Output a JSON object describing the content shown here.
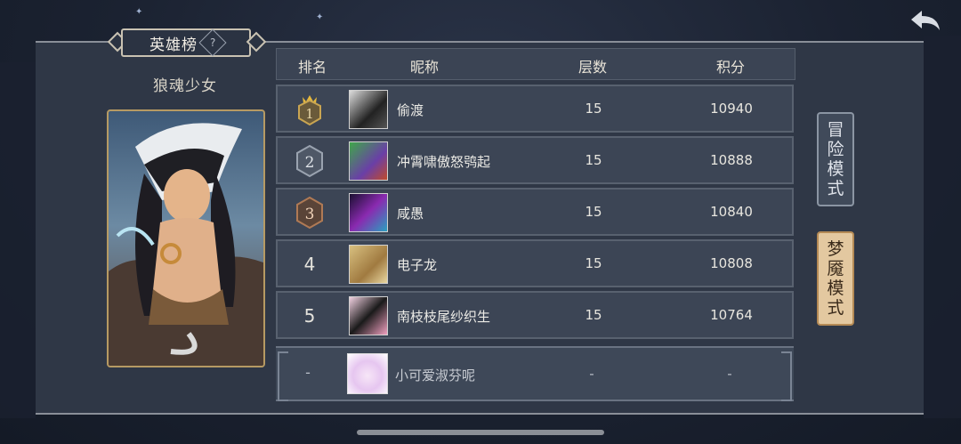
{
  "header": {
    "title": "英雄榜",
    "help_icon_text": "?"
  },
  "hero": {
    "name": "狼魂少女"
  },
  "table": {
    "columns": [
      "排名",
      "昵称",
      "层数",
      "积分"
    ],
    "rows": [
      {
        "rank": "1",
        "name": "偷渡",
        "floor": "15",
        "score": "10940"
      },
      {
        "rank": "2",
        "name": "冲霄啸傲怒鸮起",
        "floor": "15",
        "score": "10888"
      },
      {
        "rank": "3",
        "name": "咸愚",
        "floor": "15",
        "score": "10840"
      },
      {
        "rank": "4",
        "name": "电子龙",
        "floor": "15",
        "score": "10808"
      },
      {
        "rank": "5",
        "name": "南枝枝尾纱织生",
        "floor": "15",
        "score": "10764"
      }
    ],
    "self": {
      "rank": "-",
      "name": "小可爱淑芬呢",
      "floor": "-",
      "score": "-"
    }
  },
  "modes": {
    "adventure": [
      "冒",
      "险",
      "模",
      "式"
    ],
    "nightmare": [
      "梦",
      "魇",
      "模",
      "式"
    ]
  },
  "colors": {
    "gold": "#c9a552",
    "silver": "#9aa3b0",
    "bronze": "#b07a55",
    "accent": "#e3c8a0"
  }
}
